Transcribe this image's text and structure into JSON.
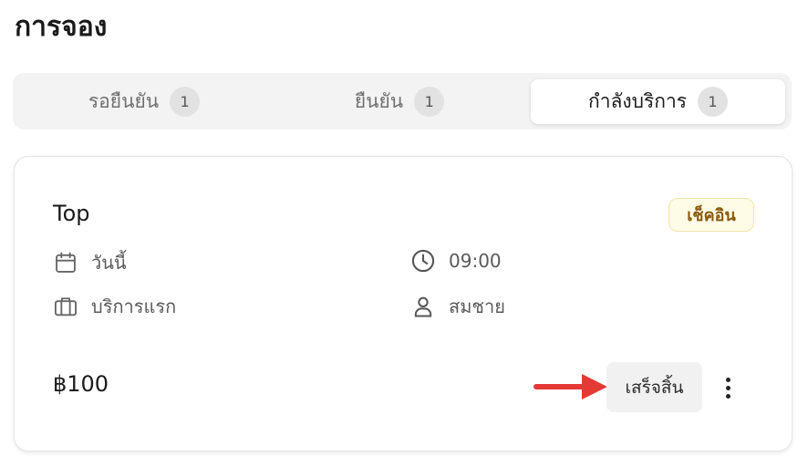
{
  "page": {
    "title": "การจอง"
  },
  "tabs": [
    {
      "label": "รอยืนยัน",
      "count": "1",
      "active": false
    },
    {
      "label": "ยืนยัน",
      "count": "1",
      "active": false
    },
    {
      "label": "กำลังบริการ",
      "count": "1",
      "active": true
    }
  ],
  "booking": {
    "name": "Top",
    "status": "เช็คอิน",
    "date": "วันนี้",
    "time": "09:00",
    "service": "บริการแรก",
    "staff": "สมชาย",
    "price": "฿100",
    "finish_label": "เสร็จสิ้น"
  },
  "icons": {
    "date": "calendar-icon",
    "time": "clock-icon",
    "service": "briefcase-icon",
    "staff": "user-icon",
    "more": "more-vertical-icon",
    "pointer": "red-arrow-icon"
  },
  "colors": {
    "badge_bg": "#fefbe6",
    "badge_text": "#8a5a0c",
    "arrow": "#e53935"
  }
}
